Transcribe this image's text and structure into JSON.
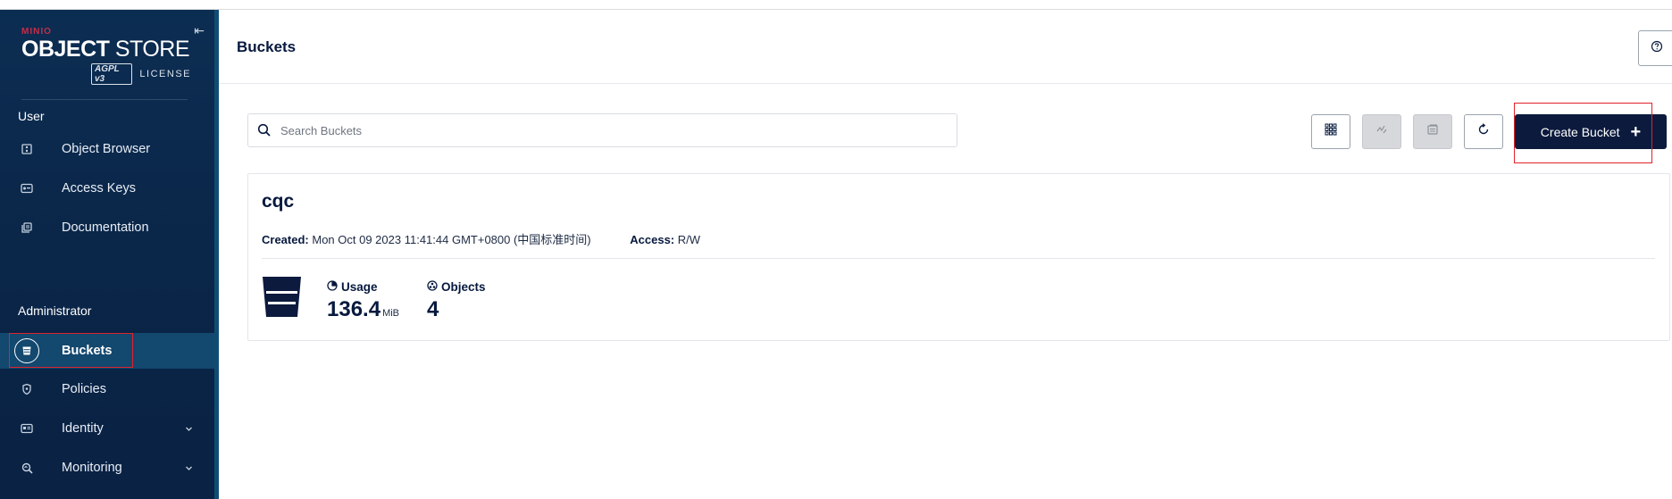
{
  "logo": {
    "brand": "MINIO",
    "title_bold": "OBJECT",
    "title_light": " STORE",
    "agpl": "AGPL v3",
    "license": "LICENSE"
  },
  "sidebar": {
    "sections": [
      {
        "title": "User"
      },
      {
        "title": "Administrator"
      }
    ],
    "items": [
      {
        "label": "Object Browser",
        "icon": "object-browser-icon"
      },
      {
        "label": "Access Keys",
        "icon": "access-keys-icon"
      },
      {
        "label": "Documentation",
        "icon": "documentation-icon"
      },
      {
        "label": "Buckets",
        "icon": "bucket-icon",
        "active": true
      },
      {
        "label": "Policies",
        "icon": "shield-icon"
      },
      {
        "label": "Identity",
        "icon": "identity-icon",
        "expandable": true
      },
      {
        "label": "Monitoring",
        "icon": "monitoring-icon",
        "expandable": true
      }
    ]
  },
  "header": {
    "title": "Buckets"
  },
  "search": {
    "placeholder": "Search Buckets",
    "value": ""
  },
  "toolbar": {
    "create_label": "Create Bucket"
  },
  "buckets": [
    {
      "name": "cqc",
      "created_label": "Created:",
      "created_value": "Mon Oct 09 2023 11:41:44 GMT+0800 (中国标准时间)",
      "access_label": "Access:",
      "access_value": "R/W",
      "usage_label": "Usage",
      "usage_value": "136.4",
      "usage_unit": "MiB",
      "objects_label": "Objects",
      "objects_value": "4"
    }
  ],
  "colors": {
    "sidebar_bg": "#0c2d52",
    "active_item": "#13486f",
    "primary_button": "#0c1a3d",
    "highlight": "#e0222b"
  }
}
